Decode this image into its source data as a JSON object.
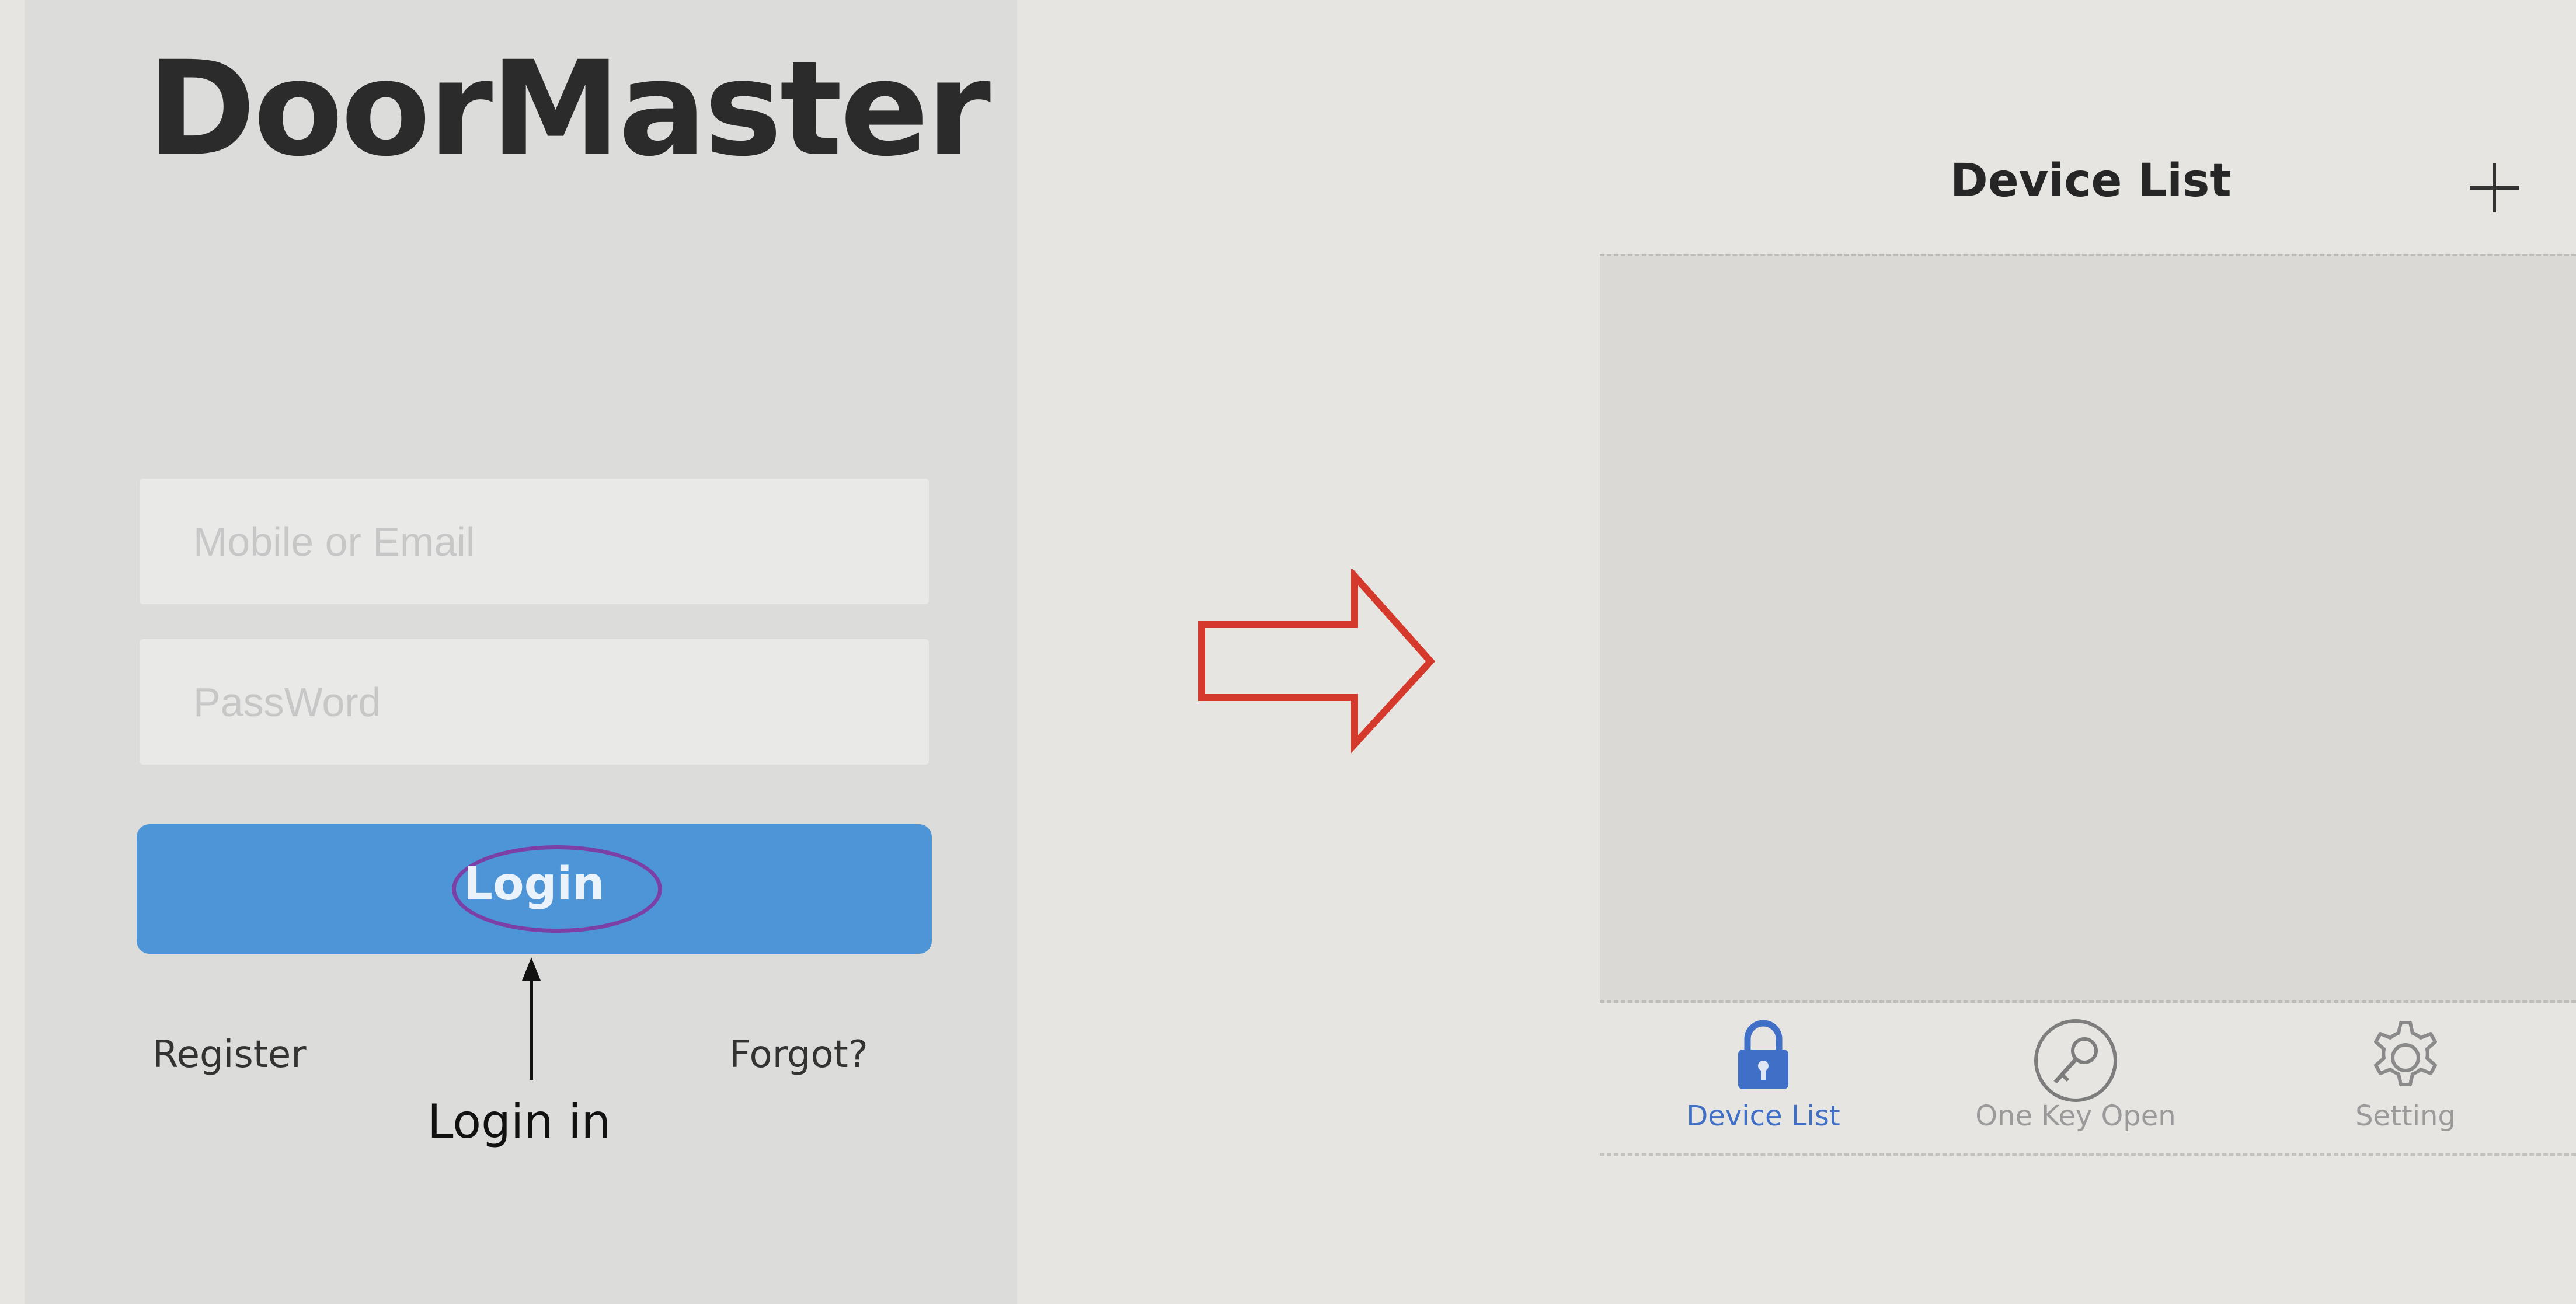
{
  "login": {
    "app_title": "DoorMaster",
    "username_placeholder": "Mobile or Email",
    "password_placeholder": "PassWord",
    "login_label": "Login",
    "register_label": "Register",
    "forgot_label": "Forgot?",
    "annotation": "Login in"
  },
  "device_list": {
    "title": "Device List",
    "add_icon": "plus-icon"
  },
  "tab_bar": {
    "tabs": [
      {
        "label": "Device List",
        "icon": "lock-icon",
        "active": true
      },
      {
        "label": "One Key Open",
        "icon": "key-icon",
        "active": false
      },
      {
        "label": "Setting",
        "icon": "gear-icon",
        "active": false
      }
    ]
  },
  "colors": {
    "accent_blue": "#4e95d7",
    "active_tab": "#3f6fc6",
    "arrow_red": "#d4392b",
    "highlight_purple": "#7b3fa6"
  }
}
